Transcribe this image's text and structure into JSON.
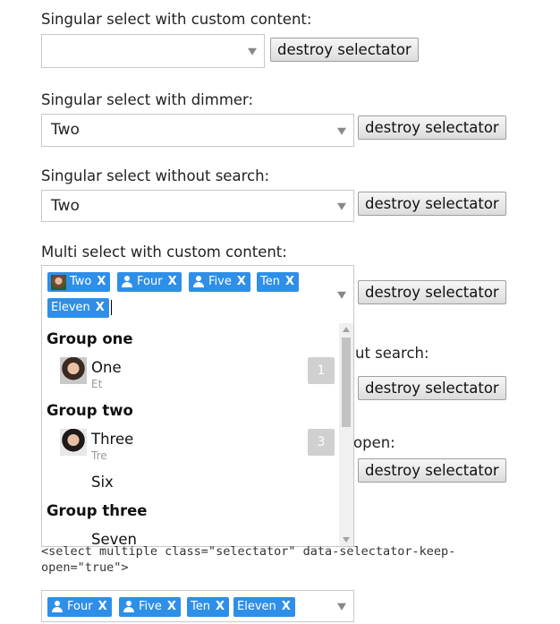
{
  "sections": {
    "custom_content": {
      "label": "Singular select with custom content:",
      "value": "",
      "button": "destroy selectator"
    },
    "dimmer": {
      "label": "Singular select with dimmer:",
      "value": "Two",
      "button": "destroy selectator"
    },
    "no_search": {
      "label": "Singular select without search:",
      "value": "Two",
      "button": "destroy selectator"
    },
    "multi_custom": {
      "label": "Multi select with custom content:",
      "button": "destroy selectator",
      "chips": [
        {
          "label": "Two",
          "x": "X",
          "icon": "avatar"
        },
        {
          "label": "Four",
          "x": "X",
          "icon": "person-icon"
        },
        {
          "label": "Five",
          "x": "X",
          "icon": "person-icon"
        },
        {
          "label": "Ten",
          "x": "X",
          "icon": "none"
        },
        {
          "label": "Eleven",
          "x": "X",
          "icon": "none"
        }
      ]
    },
    "multi_no_search": {
      "label_partial": "ut search:",
      "button": "destroy selectator"
    },
    "keep_open": {
      "label_partial": "open:",
      "button": "destroy selectator"
    },
    "bottom_multi": {
      "chips": [
        {
          "label": "Four",
          "x": "X",
          "icon": "person-icon"
        },
        {
          "label": "Five",
          "x": "X",
          "icon": "person-icon"
        },
        {
          "label": "Ten",
          "x": "X",
          "icon": "none"
        },
        {
          "label": "Eleven",
          "x": "X",
          "icon": "none"
        }
      ]
    }
  },
  "dropdown": {
    "groups": [
      {
        "title": "Group one",
        "options": [
          {
            "label": "One",
            "sub": "Et",
            "badge": "1",
            "avatar": true
          }
        ]
      },
      {
        "title": "Group two",
        "options": [
          {
            "label": "Three",
            "sub": "Tre",
            "badge": "3",
            "avatar": true
          },
          {
            "label": "Six",
            "sub": "",
            "badge": "",
            "avatar": false
          }
        ]
      },
      {
        "title": "Group three",
        "options": [
          {
            "label": "Seven",
            "sub": "",
            "badge": "",
            "avatar": false
          }
        ]
      }
    ]
  },
  "code_snippet": "<select multiple class=\"selectator\" data-selectator-keep-open=\"true\">",
  "colors": {
    "chip": "#2e8fe8",
    "badge": "#d0d0d0",
    "border": "#c8c8c8"
  }
}
